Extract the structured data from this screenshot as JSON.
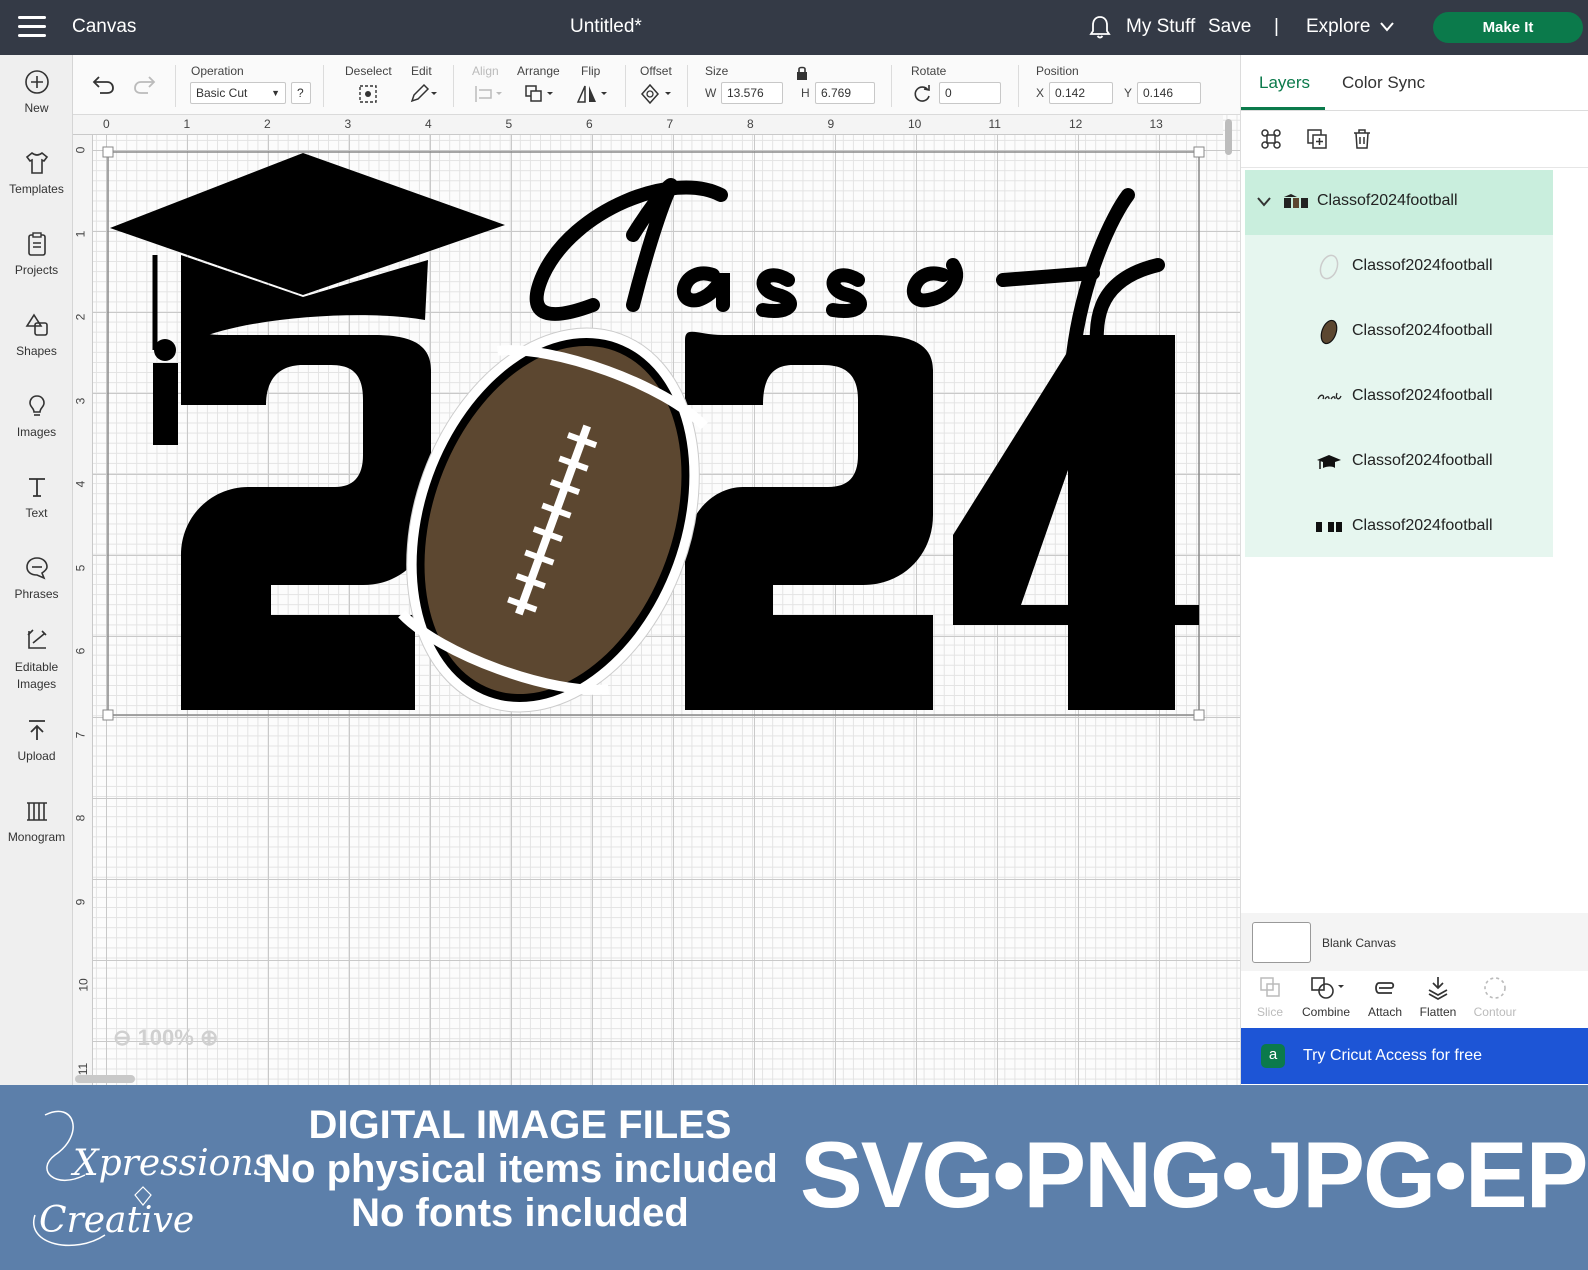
{
  "header": {
    "app_name": "Canvas",
    "document_title": "Untitled*",
    "my_stuff": "My Stuff",
    "save": "Save",
    "separator": "|",
    "explore": "Explore",
    "make_it": "Make It"
  },
  "left_toolbar": {
    "items": [
      {
        "label": "New",
        "icon": "plus-circle-icon"
      },
      {
        "label": "Templates",
        "icon": "shirt-icon"
      },
      {
        "label": "Projects",
        "icon": "clipboard-icon"
      },
      {
        "label": "Shapes",
        "icon": "shapes-icon"
      },
      {
        "label": "Images",
        "icon": "lightbulb-icon"
      },
      {
        "label": "Text",
        "icon": "text-t-icon"
      },
      {
        "label": "Phrases",
        "icon": "speech-bubble-icon"
      },
      {
        "label": "Editable Images",
        "icon": "edit-image-icon"
      },
      {
        "label": "Upload",
        "icon": "upload-icon"
      },
      {
        "label": "Monogram",
        "icon": "monogram-icon"
      }
    ]
  },
  "toolbar": {
    "operation_label": "Operation",
    "operation_value": "Basic Cut",
    "help": "?",
    "deselect": "Deselect",
    "edit": "Edit",
    "align": "Align",
    "arrange": "Arrange",
    "flip": "Flip",
    "offset": "Offset",
    "size_label": "Size",
    "w_label": "W",
    "w_value": "13.576",
    "h_label": "H",
    "h_value": "6.769",
    "rotate_label": "Rotate",
    "rotate_value": "0",
    "position_label": "Position",
    "x_label": "X",
    "x_value": "0.142",
    "y_label": "Y",
    "y_value": "0.146"
  },
  "ruler": {
    "top": [
      "0",
      "1",
      "2",
      "3",
      "4",
      "5",
      "6",
      "7",
      "8",
      "9",
      "10",
      "11",
      "12",
      "13"
    ],
    "left": [
      "0",
      "1",
      "2",
      "3",
      "4",
      "5",
      "6",
      "7",
      "8",
      "9",
      "10",
      "11"
    ]
  },
  "canvas": {
    "zoom": "100%",
    "design": {
      "script_text": "Class of",
      "year_left": "2",
      "year_right": "24",
      "football_color": "#5c4730"
    }
  },
  "right_panel": {
    "tabs": [
      "Layers",
      "Color Sync"
    ],
    "group_name": "Classof2024football",
    "layers": [
      {
        "name": "Classof2024football",
        "icon": "outline-layer-icon"
      },
      {
        "name": "Classof2024football",
        "icon": "football-icon"
      },
      {
        "name": "Classof2024football",
        "icon": "script-text-icon"
      },
      {
        "name": "Classof2024football",
        "icon": "grad-cap-icon"
      },
      {
        "name": "Classof2024football",
        "icon": "numbers-icon"
      }
    ],
    "blank_canvas": "Blank Canvas",
    "bottom_tools": [
      "Slice",
      "Combine",
      "Attach",
      "Flatten",
      "Contour"
    ],
    "cricut_access": "Try Cricut Access for free"
  },
  "footer": {
    "logo_line1": "Xpressions",
    "logo_line2": "Creative",
    "info_lines": [
      "DIGITAL IMAGE FILES",
      "No physical items included",
      "No fonts included"
    ],
    "formats": "SVG•PNG•JPG•EPS"
  },
  "colors": {
    "header_bg": "#343a46",
    "make_it": "#0b7a4b",
    "layer_highlight": "#d5f1e4",
    "cricut_access": "#1d55d6",
    "footer_bg": "#5c7faa"
  }
}
